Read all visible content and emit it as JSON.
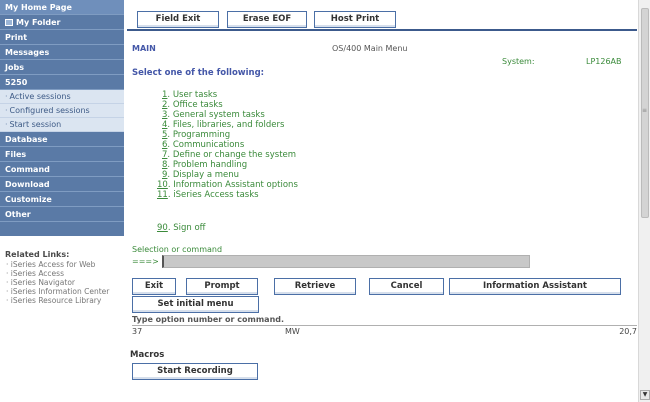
{
  "sidebar": {
    "top": "My Home Page",
    "folder": "My Folder",
    "items_a": [
      "Print",
      "Messages",
      "Jobs",
      "5250"
    ],
    "subitems": [
      "Active sessions",
      "Configured sessions",
      "Start session"
    ],
    "items_b": [
      "Database",
      "Files",
      "Command",
      "Download",
      "Customize",
      "Other"
    ],
    "related_title": "Related Links:",
    "related_links": [
      "iSeries Access for Web",
      "iSeries Access",
      "iSeries Navigator",
      "iSeries Information Center",
      "iSeries Resource Library"
    ]
  },
  "toolbar": {
    "field_exit": "Field Exit",
    "erase_eof": "Erase EOF",
    "host_print": "Host Print"
  },
  "screen": {
    "menu_name": "MAIN",
    "menu_title": "OS/400 Main Menu",
    "system_label": "System:",
    "system_value": "LP126AB",
    "prompt": "Select one of the following:",
    "options": [
      {
        "num": "1",
        "label": ". User tasks"
      },
      {
        "num": "2",
        "label": ". Office tasks"
      },
      {
        "num": "3",
        "label": ". General system tasks"
      },
      {
        "num": "4",
        "label": ". Files, libraries, and folders"
      },
      {
        "num": "5",
        "label": ". Programming"
      },
      {
        "num": "6",
        "label": ". Communications"
      },
      {
        "num": "7",
        "label": ". Define or change the system"
      },
      {
        "num": "8",
        "label": ". Problem handling"
      },
      {
        "num": "9",
        "label": ". Display a menu"
      },
      {
        "num": "10",
        "label": ". Information Assistant options"
      },
      {
        "num": "11",
        "label": ". iSeries Access tasks"
      }
    ],
    "signoff_num": "90",
    "signoff_label": ". Sign off",
    "selection_label": "Selection or command",
    "arrow": "===>",
    "command_value": ""
  },
  "function_keys": {
    "exit": "Exit",
    "prompt": "Prompt",
    "retrieve": "Retrieve",
    "cancel": "Cancel",
    "info_assistant": "Information Assistant",
    "set_initial_menu": "Set initial menu"
  },
  "status": {
    "message": "Type option number or command.",
    "left": "37",
    "middle": "MW",
    "right": "20,7"
  },
  "macros": {
    "title": "Macros",
    "start_recording": "Start Recording"
  }
}
